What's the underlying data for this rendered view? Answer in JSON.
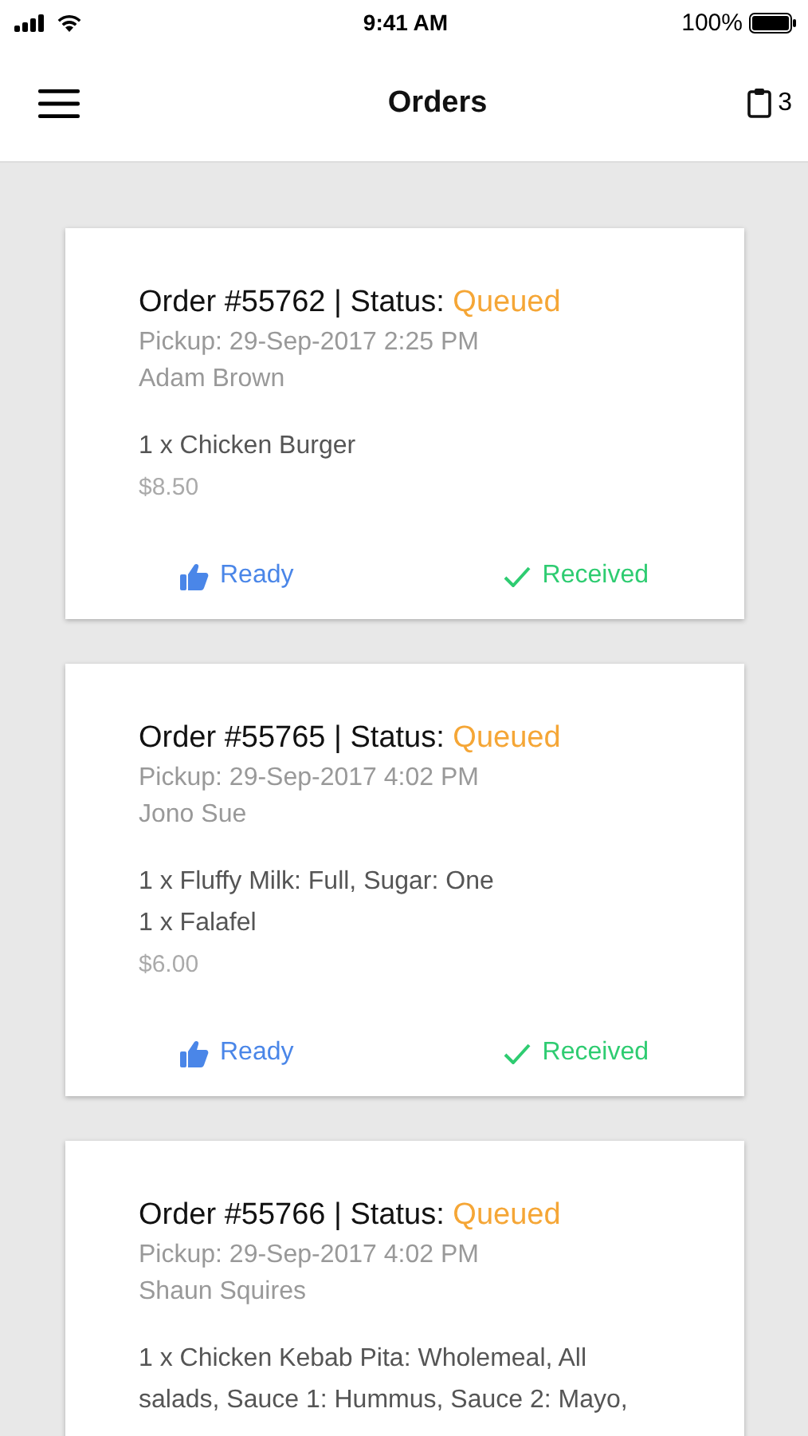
{
  "status_bar": {
    "time": "9:41 AM",
    "battery": "100%"
  },
  "nav": {
    "title": "Orders",
    "count": "3"
  },
  "orders": [
    {
      "title": "Order #55762 | Status:",
      "status": "Queued",
      "pickup": "Pickup: 29-Sep-2017 2:25 PM",
      "customer": "Adam Brown",
      "items": [
        "1 x Chicken Burger"
      ],
      "price": "$8.50",
      "actions": {
        "ready": "Ready",
        "received": "Received"
      }
    },
    {
      "title": "Order #55765 | Status:",
      "status": "Queued",
      "pickup": "Pickup: 29-Sep-2017 4:02 PM",
      "customer": "Jono Sue",
      "items": [
        "1 x Fluffy Milk: Full, Sugar: One",
        "1 x Falafel"
      ],
      "price": "$6.00",
      "actions": {
        "ready": "Ready",
        "received": "Received"
      }
    },
    {
      "title": "Order #55766 | Status:",
      "status": "Queued",
      "pickup": "Pickup: 29-Sep-2017 4:02 PM",
      "customer": "Shaun Squires",
      "items": [
        "1 x Chicken Kebab Pita: Wholemeal, All salads, Sauce 1: Hummus, Sauce 2: Mayo,"
      ]
    }
  ]
}
